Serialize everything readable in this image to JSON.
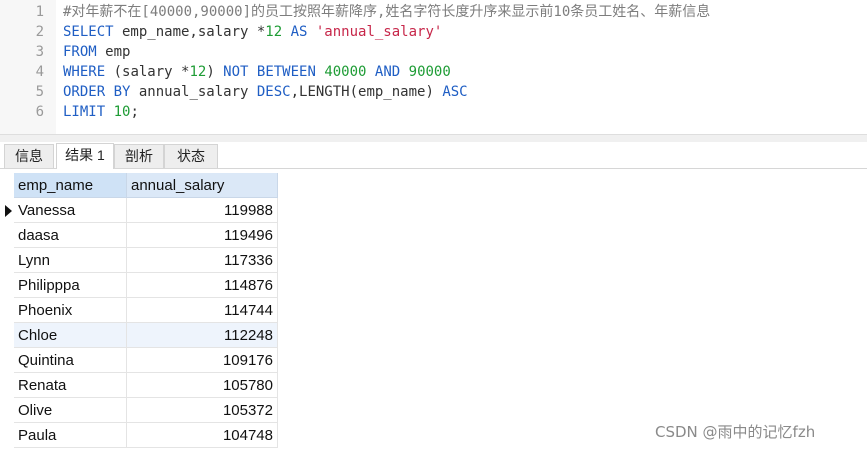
{
  "editor": {
    "lines": [
      {
        "num": "1",
        "tokens": [
          {
            "t": "#对年薪不在[40000,90000]的员工按照年薪降序,姓名字符长度升序来显示前10条员工姓名、年薪信息",
            "c": "cm"
          }
        ]
      },
      {
        "num": "2",
        "tokens": [
          {
            "t": "SELECT",
            "c": "kw"
          },
          {
            "t": " emp_name,salary *",
            "c": "tx"
          },
          {
            "t": "12",
            "c": "num"
          },
          {
            "t": " AS ",
            "c": "kw"
          },
          {
            "t": "'annual_salary'",
            "c": "str"
          }
        ]
      },
      {
        "num": "3",
        "tokens": [
          {
            "t": "FROM",
            "c": "kw"
          },
          {
            "t": " emp",
            "c": "tx"
          }
        ]
      },
      {
        "num": "4",
        "tokens": [
          {
            "t": "WHERE",
            "c": "kw"
          },
          {
            "t": " (salary *",
            "c": "tx"
          },
          {
            "t": "12",
            "c": "num"
          },
          {
            "t": ") ",
            "c": "tx"
          },
          {
            "t": "NOT BETWEEN",
            "c": "kw"
          },
          {
            "t": " ",
            "c": "tx"
          },
          {
            "t": "40000",
            "c": "num"
          },
          {
            "t": " AND ",
            "c": "kw"
          },
          {
            "t": "90000",
            "c": "num"
          }
        ]
      },
      {
        "num": "5",
        "tokens": [
          {
            "t": "ORDER BY",
            "c": "kw"
          },
          {
            "t": " annual_salary ",
            "c": "tx"
          },
          {
            "t": "DESC",
            "c": "kw"
          },
          {
            "t": ",LENGTH(emp_name) ",
            "c": "tx"
          },
          {
            "t": "ASC",
            "c": "kw"
          }
        ]
      },
      {
        "num": "6",
        "tokens": [
          {
            "t": "LIMIT",
            "c": "kw"
          },
          {
            "t": " ",
            "c": "tx"
          },
          {
            "t": "10",
            "c": "num"
          },
          {
            "t": ";",
            "c": "tx"
          }
        ]
      }
    ]
  },
  "tabs": [
    {
      "label": "信息",
      "active": false
    },
    {
      "label": "结果 1",
      "active": true
    },
    {
      "label": "剖析",
      "active": false
    },
    {
      "label": "状态",
      "active": false
    }
  ],
  "result": {
    "columns": [
      "emp_name",
      "annual_salary"
    ],
    "rows": [
      [
        "Vanessa",
        "119988"
      ],
      [
        "daasa",
        "119496"
      ],
      [
        "Lynn",
        "117336"
      ],
      [
        "Philipppa",
        "114876"
      ],
      [
        "Phoenix",
        "114744"
      ],
      [
        "Chloe",
        "112248"
      ],
      [
        "Quintina",
        "109176"
      ],
      [
        "Renata",
        "105780"
      ],
      [
        "Olive",
        "105372"
      ],
      [
        "Paula",
        "104748"
      ]
    ]
  },
  "watermark": "CSDN @雨中的记忆fzh"
}
